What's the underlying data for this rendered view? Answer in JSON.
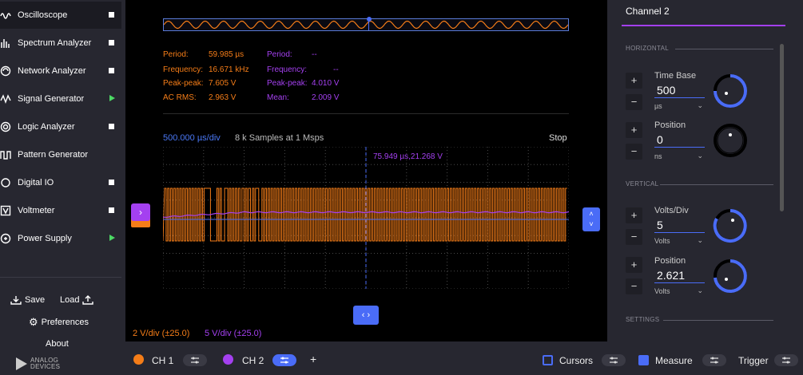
{
  "sidebar": {
    "tools": [
      {
        "label": "Oscilloscope",
        "icon": "oscilloscope-icon",
        "state": "stop",
        "active": true
      },
      {
        "label": "Spectrum Analyzer",
        "icon": "spectrum-icon",
        "state": "stop"
      },
      {
        "label": "Network Analyzer",
        "icon": "network-icon",
        "state": "stop"
      },
      {
        "label": "Signal Generator",
        "icon": "signal-generator-icon",
        "state": "play"
      },
      {
        "label": "Logic Analyzer",
        "icon": "logic-icon",
        "state": "stop"
      },
      {
        "label": "Pattern Generator",
        "icon": "pattern-icon",
        "state": "none"
      },
      {
        "label": "Digital IO",
        "icon": "digital-io-icon",
        "state": "stop"
      },
      {
        "label": "Voltmeter",
        "icon": "voltmeter-icon",
        "state": "stop"
      },
      {
        "label": "Power Supply",
        "icon": "power-icon",
        "state": "play"
      }
    ],
    "save_label": "Save",
    "load_label": "Load",
    "preferences_label": "Preferences",
    "about_label": "About",
    "brand_line1": "ANALOG",
    "brand_line2": "DEVICES"
  },
  "measurements": {
    "ch1": [
      {
        "label": "Period:",
        "value": "59.985 µs"
      },
      {
        "label": "Frequency:",
        "value": "16.671 kHz"
      },
      {
        "label": "Peak-peak:",
        "value": "7.605 V"
      },
      {
        "label": "AC RMS:",
        "value": "2.963 V"
      }
    ],
    "ch2": [
      {
        "label": "Period:",
        "value": "--"
      },
      {
        "label": "Frequency:",
        "value": "--"
      },
      {
        "label": "Peak-peak:",
        "value": "4.010 V"
      },
      {
        "label": "Mean:",
        "value": "2.009 V"
      }
    ]
  },
  "plot": {
    "timebase": "500.000 µs/div",
    "samples": "8 k Samples at 1 Msps",
    "status": "Stop",
    "cursor_readout": "75.949 µs,21.268 V",
    "ch2_handle_glyph": "›",
    "trigger_handle_up": "˄",
    "trigger_handle_down": "˅",
    "hpos_handle_glyph": "‹ ›",
    "ch1_scale": "2 V/div (±25.0)",
    "ch2_scale": "5 V/div (±25.0)"
  },
  "panel": {
    "title": "Channel 2",
    "horizontal_title": "HORIZONTAL",
    "vertical_title": "VERTICAL",
    "settings_title": "SETTINGS",
    "plus": "+",
    "minus": "−",
    "chevron": "⌄",
    "time_base": {
      "label": "Time Base",
      "value": "500",
      "unit": "µs"
    },
    "h_position": {
      "label": "Position",
      "value": "0",
      "unit": "ns"
    },
    "volts_div": {
      "label": "Volts/Div",
      "value": "5",
      "unit": "Volts"
    },
    "v_position": {
      "label": "Position",
      "value": "2.621",
      "unit": "Volts"
    }
  },
  "bottombar": {
    "ch1_label": "CH 1",
    "ch2_label": "CH 2",
    "add_label": "+",
    "cursors_label": "Cursors",
    "measure_label": "Measure",
    "trigger_label": "Trigger",
    "cursors_enabled": false,
    "measure_enabled": true
  },
  "colors": {
    "ch1": "#f57d18",
    "ch2": "#a440f0",
    "accent": "#4a6cf7",
    "grid": "#4a4a4a"
  }
}
